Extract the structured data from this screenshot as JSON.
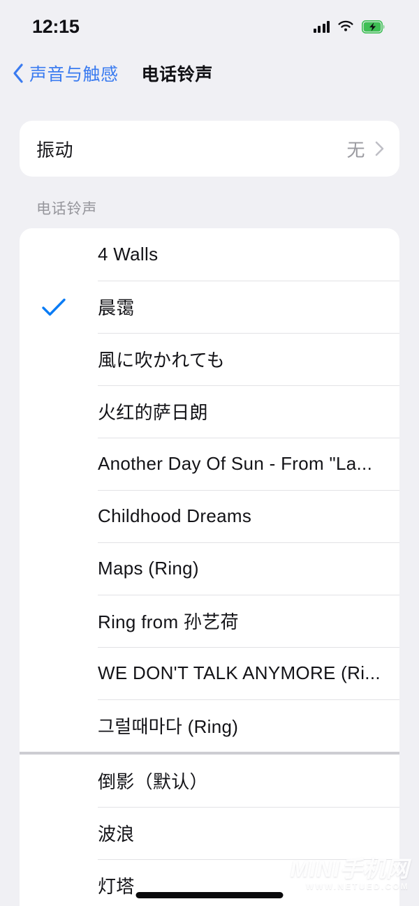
{
  "status_bar": {
    "time": "12:15",
    "signal_icon": "cellular-signal-icon",
    "wifi_icon": "wifi-icon",
    "battery_icon": "battery-charging-icon",
    "battery_charging": true
  },
  "nav": {
    "back_label": "声音与触感",
    "back_icon": "chevron-left-icon",
    "title": "电话铃声"
  },
  "vibration": {
    "label": "振动",
    "value": "无",
    "chevron_icon": "chevron-right-icon"
  },
  "ringtones": {
    "section_header": "电话铃声",
    "selected": "晨霭",
    "check_icon": "checkmark-icon",
    "accent_color": "#0a7cf5",
    "custom_items": [
      {
        "label": "4 Walls",
        "selected": false
      },
      {
        "label": "晨霭",
        "selected": true
      },
      {
        "label": "風に吹かれても",
        "selected": false
      },
      {
        "label": "火红的萨日朗",
        "selected": false
      },
      {
        "label": "Another Day Of Sun - From \"La...",
        "selected": false
      },
      {
        "label": "Childhood Dreams",
        "selected": false
      },
      {
        "label": "Maps (Ring)",
        "selected": false
      },
      {
        "label": "Ring from 孙艺荷",
        "selected": false
      },
      {
        "label": "WE DON'T TALK ANYMORE (Ri...",
        "selected": false
      },
      {
        "label": "그럴때마다 (Ring)",
        "selected": false
      }
    ],
    "default_items": [
      {
        "label": "倒影（默认）",
        "selected": false
      },
      {
        "label": "波浪",
        "selected": false
      },
      {
        "label": "灯塔",
        "selected": false
      }
    ]
  },
  "watermark": {
    "main": "MINI手机网",
    "sub": "WWW.NETUED.COM"
  },
  "home_indicator": "home-indicator"
}
